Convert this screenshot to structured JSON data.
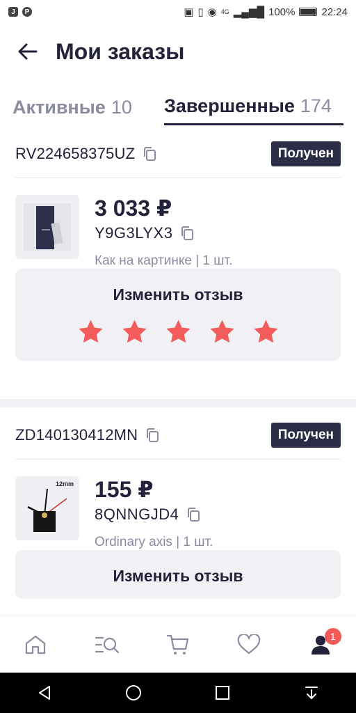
{
  "status_bar": {
    "left_apps": [
      "J",
      "P"
    ],
    "battery": "100%",
    "time": "22:24",
    "network": "4G"
  },
  "header": {
    "title": "Мои заказы"
  },
  "tabs": [
    {
      "label": "Активные",
      "count": "10"
    },
    {
      "label": "Завершенные",
      "count": "174"
    }
  ],
  "orders": [
    {
      "tracking": "RV224658375UZ",
      "status": "Получен",
      "price": "3 033 ₽",
      "sku": "Y9G3LYX3",
      "variant": "Как на картинке | 1 шт.",
      "review_label": "Изменить отзыв",
      "rating": 5
    },
    {
      "tracking": "ZD140130412MN",
      "status": "Получен",
      "price": "155 ₽",
      "sku": "8QNNGJD4",
      "variant": "Ordinary axis | 1 шт.",
      "thumb_text": "12mm",
      "review_label": "Изменить отзыв"
    }
  ],
  "bottom_nav": {
    "items": [
      "home-icon",
      "catalog-search-icon",
      "cart-icon",
      "favorites-icon",
      "profile-icon"
    ],
    "profile_badge": "1"
  },
  "colors": {
    "primary": "#22223a",
    "muted": "#8b8c9f",
    "star": "#f45b5b",
    "badge_bg": "#2b2c45"
  }
}
